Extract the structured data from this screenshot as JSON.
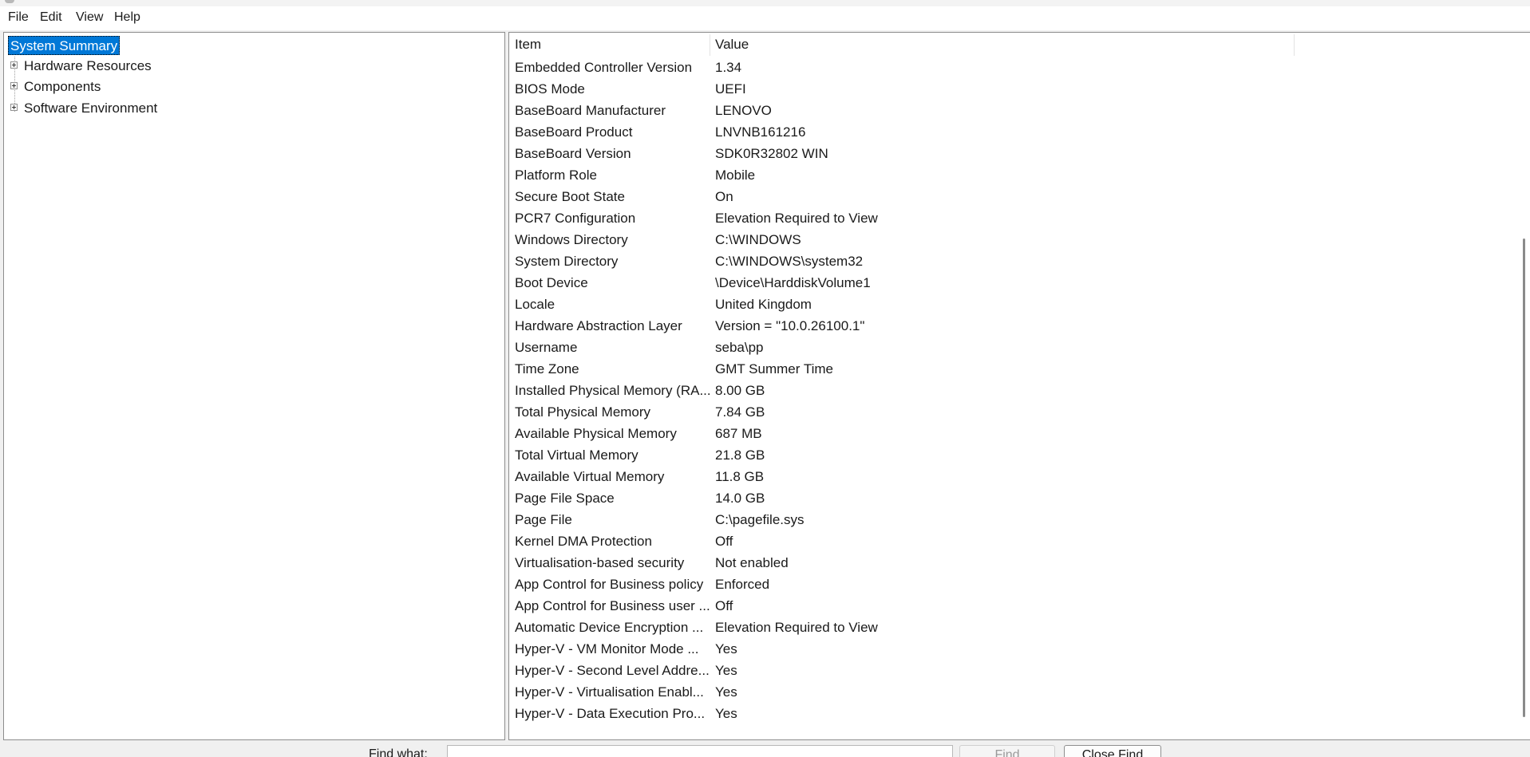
{
  "menu": {
    "file": "File",
    "edit": "Edit",
    "view": "View",
    "help": "Help"
  },
  "tree": {
    "selected": "System Summary",
    "nodes": [
      {
        "label": "Hardware Resources",
        "icon": "plus-expander-icon"
      },
      {
        "label": "Components",
        "icon": "plus-expander-icon"
      },
      {
        "label": "Software Environment",
        "icon": "plus-expander-icon"
      }
    ]
  },
  "list": {
    "columns": {
      "item": "Item",
      "value": "Value"
    },
    "rows": [
      {
        "item": "Embedded Controller Version",
        "value": "1.34"
      },
      {
        "item": "BIOS Mode",
        "value": "UEFI"
      },
      {
        "item": "BaseBoard Manufacturer",
        "value": "LENOVO"
      },
      {
        "item": "BaseBoard Product",
        "value": "LNVNB161216"
      },
      {
        "item": "BaseBoard Version",
        "value": "SDK0R32802 WIN"
      },
      {
        "item": "Platform Role",
        "value": "Mobile"
      },
      {
        "item": "Secure Boot State",
        "value": "On"
      },
      {
        "item": "PCR7 Configuration",
        "value": "Elevation Required to View"
      },
      {
        "item": "Windows Directory",
        "value": "C:\\WINDOWS"
      },
      {
        "item": "System Directory",
        "value": "C:\\WINDOWS\\system32"
      },
      {
        "item": "Boot Device",
        "value": "\\Device\\HarddiskVolume1"
      },
      {
        "item": "Locale",
        "value": "United Kingdom"
      },
      {
        "item": "Hardware Abstraction Layer",
        "value": "Version = \"10.0.26100.1\""
      },
      {
        "item": "Username",
        "value": "seba\\pp"
      },
      {
        "item": "Time Zone",
        "value": "GMT Summer Time"
      },
      {
        "item": "Installed Physical Memory (RA...",
        "value": "8.00 GB"
      },
      {
        "item": "Total Physical Memory",
        "value": "7.84 GB"
      },
      {
        "item": "Available Physical Memory",
        "value": "687 MB"
      },
      {
        "item": "Total Virtual Memory",
        "value": "21.8 GB"
      },
      {
        "item": "Available Virtual Memory",
        "value": "11.8 GB"
      },
      {
        "item": "Page File Space",
        "value": "14.0 GB"
      },
      {
        "item": "Page File",
        "value": "C:\\pagefile.sys"
      },
      {
        "item": "Kernel DMA Protection",
        "value": "Off"
      },
      {
        "item": "Virtualisation-based security",
        "value": "Not enabled"
      },
      {
        "item": "App Control for Business policy",
        "value": "Enforced"
      },
      {
        "item": "App Control for Business user ...",
        "value": "Off"
      },
      {
        "item": "Automatic Device Encryption ...",
        "value": "Elevation Required to View"
      },
      {
        "item": "Hyper-V - VM Monitor Mode ...",
        "value": "Yes"
      },
      {
        "item": "Hyper-V - Second Level Addre...",
        "value": "Yes"
      },
      {
        "item": "Hyper-V - Virtualisation Enabl...",
        "value": "Yes"
      },
      {
        "item": "Hyper-V - Data Execution Pro...",
        "value": "Yes"
      }
    ]
  },
  "find": {
    "label": "Find what:",
    "value": "",
    "find_button": "Find",
    "close_button": "Close Find"
  },
  "colors": {
    "selection": "#0078d7",
    "pane_border": "#8c8c8c",
    "window_bg": "#f0f0f0"
  }
}
